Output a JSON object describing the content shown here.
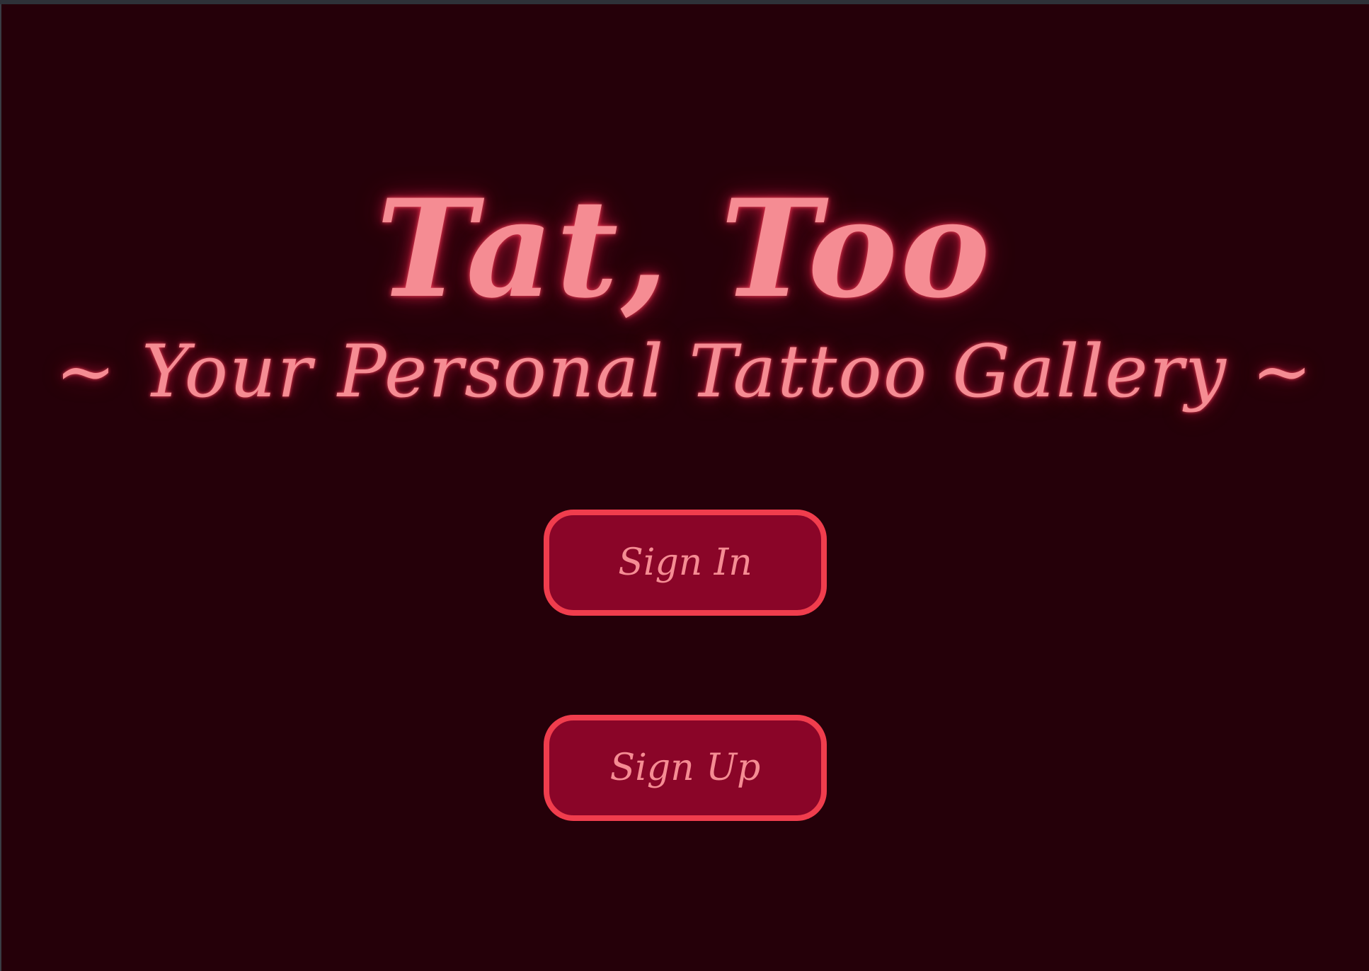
{
  "header": {
    "title": "Tat, Too",
    "subtitle": "~ Your Personal Tattoo Gallery ~"
  },
  "actions": {
    "sign_in_label": "Sign In",
    "sign_up_label": "Sign Up"
  },
  "colors": {
    "background": "#250009",
    "neon_text": "#f58c93",
    "button_fill": "#8a0528",
    "button_border": "#f03d4d"
  }
}
